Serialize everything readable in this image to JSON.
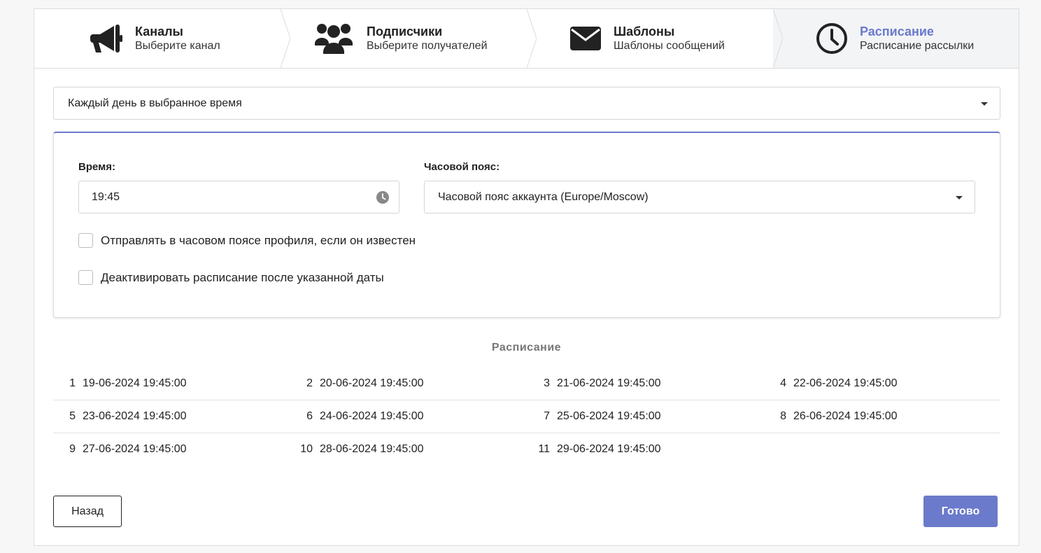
{
  "steps": [
    {
      "title": "Каналы",
      "subtitle": "Выберите канал",
      "icon": "megaphone-icon",
      "active": false
    },
    {
      "title": "Подписчики",
      "subtitle": "Выберите получателей",
      "icon": "users-icon",
      "active": false
    },
    {
      "title": "Шаблоны",
      "subtitle": "Шаблоны сообщений",
      "icon": "envelope-icon",
      "active": false
    },
    {
      "title": "Расписание",
      "subtitle": "Расписание рассылки",
      "icon": "clock-icon",
      "active": true
    }
  ],
  "frequency_select": {
    "value": "Каждый день в выбранное время"
  },
  "time_field": {
    "label": "Время:",
    "value": "19:45",
    "icon": "clock-icon"
  },
  "timezone_field": {
    "label": "Часовой пояс:",
    "value": "Часовой пояс аккаунта (Europe/Moscow)"
  },
  "checkboxes": [
    {
      "label": "Отправлять в часовом поясе профиля, если он известен",
      "checked": false
    },
    {
      "label": "Деактивировать расписание после указанной даты",
      "checked": false
    }
  ],
  "schedule": {
    "title": "Расписание",
    "items": [
      {
        "num": "1",
        "date": "19-06-2024 19:45:00"
      },
      {
        "num": "2",
        "date": "20-06-2024 19:45:00"
      },
      {
        "num": "3",
        "date": "21-06-2024 19:45:00"
      },
      {
        "num": "4",
        "date": "22-06-2024 19:45:00"
      },
      {
        "num": "5",
        "date": "23-06-2024 19:45:00"
      },
      {
        "num": "6",
        "date": "24-06-2024 19:45:00"
      },
      {
        "num": "7",
        "date": "25-06-2024 19:45:00"
      },
      {
        "num": "8",
        "date": "26-06-2024 19:45:00"
      },
      {
        "num": "9",
        "date": "27-06-2024 19:45:00"
      },
      {
        "num": "10",
        "date": "28-06-2024 19:45:00"
      },
      {
        "num": "11",
        "date": "29-06-2024 19:45:00"
      }
    ]
  },
  "buttons": {
    "back": "Назад",
    "done": "Готово"
  },
  "colors": {
    "accent": "#6b7acb",
    "border": "#dcdcdc",
    "active_step_bg": "#f3f4f6"
  }
}
